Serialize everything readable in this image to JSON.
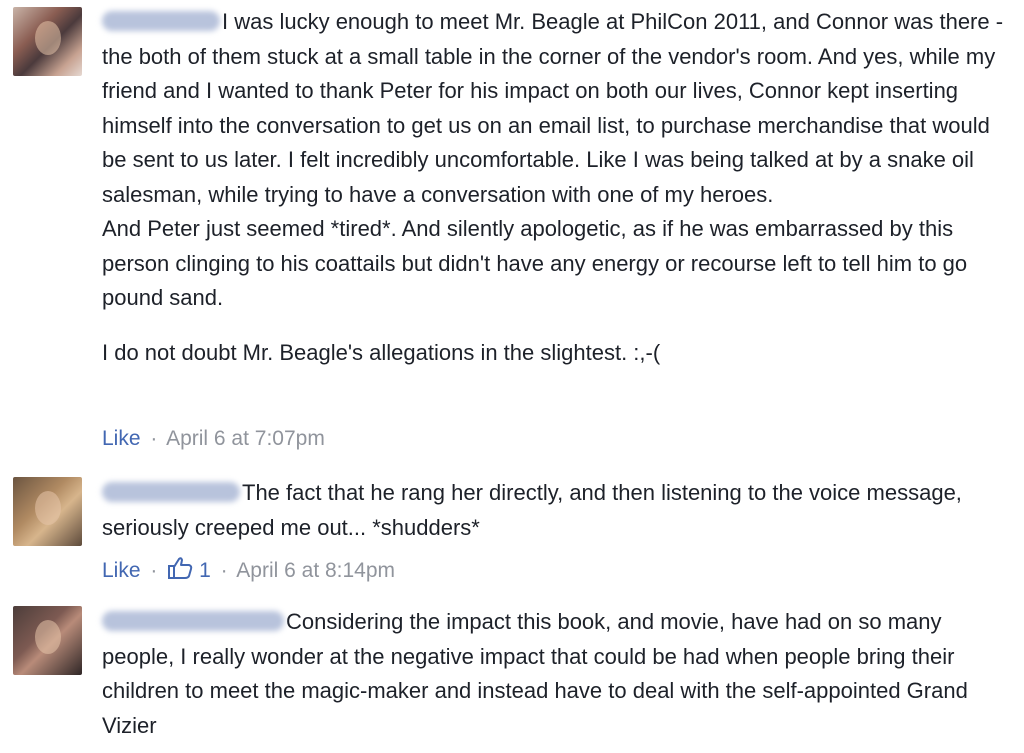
{
  "comments": [
    {
      "text_first_line": "I was lucky enough to meet Mr. Beagle at PhilCon 2011, and",
      "text_rest": "Connor was there - the both of them stuck at a small table in the corner of the vendor's room. And yes, while my friend and I wanted to thank Peter for his impact on both our lives, Connor kept inserting himself into the conversation to get us on an email list, to purchase merchandise that would be sent to us later. I felt incredibly uncomfortable. Like I was being talked at by a snake oil salesman, while trying to have a conversation with one of my heroes.",
      "text_p2": "And Peter just seemed *tired*. And silently apologetic, as if he was embarrassed by this person clinging to his coattails but didn't have any energy or recourse left to tell him to go pound sand.",
      "text_p3": "I do not doubt Mr. Beagle's allegations in the slightest. :,-(",
      "like_label": "Like",
      "separator": "·",
      "timestamp": "April 6 at 7:07pm"
    },
    {
      "text_first_line": "The fact that he rang her directly, and then listening to the voice",
      "text_rest": "message, seriously creeped me out... *shudders*",
      "like_label": "Like",
      "separator": "·",
      "like_count": "1",
      "timestamp": "April 6 at 8:14pm"
    },
    {
      "text_first_line": "Considering the impact this book, and movie, have had on so",
      "text_rest": "many people, I really wonder at the negative impact that could be had when people bring their children to meet the magic-maker and instead have to deal with the self-appointed Grand Vizier"
    }
  ],
  "icons": {
    "avatar": "avatar",
    "like": "thumbs-up-icon"
  },
  "colors": {
    "link": "#4267b2",
    "meta": "#90949c",
    "text": "#1d2129",
    "background": "#ffffff"
  }
}
